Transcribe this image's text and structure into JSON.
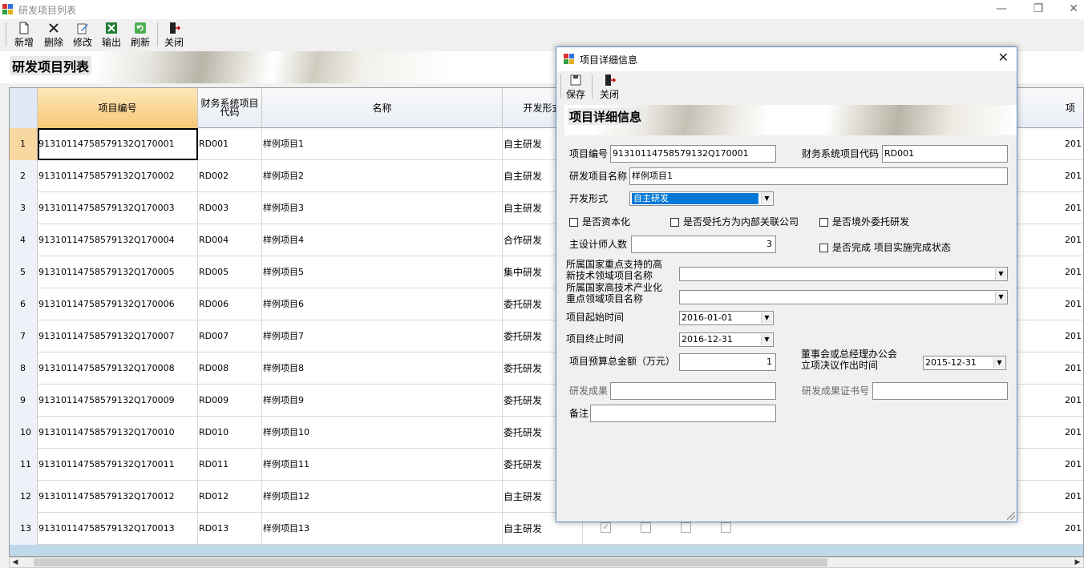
{
  "window": {
    "title": "研发项目列表"
  },
  "toolbar": {
    "new": "新增",
    "delete": "删除",
    "edit": "修改",
    "export": "输出",
    "refresh": "刷新",
    "close": "关闭"
  },
  "banner": {
    "title": "研发项目列表"
  },
  "grid": {
    "columns": [
      "项目编号",
      "财务系统项目代码",
      "名称",
      "开发形式"
    ],
    "last_col": "项",
    "rows": [
      {
        "n": "1",
        "code": "91310114758579132Q170001",
        "fin": "RD001",
        "name": "样例项目1",
        "form": "自主研发",
        "year": "201"
      },
      {
        "n": "2",
        "code": "91310114758579132Q170002",
        "fin": "RD002",
        "name": "样例项目2",
        "form": "自主研发",
        "year": "201"
      },
      {
        "n": "3",
        "code": "91310114758579132Q170003",
        "fin": "RD003",
        "name": "样例项目3",
        "form": "自主研发",
        "year": "201"
      },
      {
        "n": "4",
        "code": "91310114758579132Q170004",
        "fin": "RD004",
        "name": "样例项目4",
        "form": "合作研发",
        "year": "201"
      },
      {
        "n": "5",
        "code": "91310114758579132Q170005",
        "fin": "RD005",
        "name": "样例项目5",
        "form": "集中研发",
        "year": "201"
      },
      {
        "n": "6",
        "code": "91310114758579132Q170006",
        "fin": "RD006",
        "name": "样例项目6",
        "form": "委托研发",
        "year": "201"
      },
      {
        "n": "7",
        "code": "91310114758579132Q170007",
        "fin": "RD007",
        "name": "样例项目7",
        "form": "委托研发",
        "year": "201"
      },
      {
        "n": "8",
        "code": "91310114758579132Q170008",
        "fin": "RD008",
        "name": "样例项目8",
        "form": "委托研发",
        "year": "201"
      },
      {
        "n": "9",
        "code": "91310114758579132Q170009",
        "fin": "RD009",
        "name": "样例项目9",
        "form": "委托研发",
        "year": "201"
      },
      {
        "n": "10",
        "code": "91310114758579132Q170010",
        "fin": "RD010",
        "name": "样例项目10",
        "form": "委托研发",
        "year": "201"
      },
      {
        "n": "11",
        "code": "91310114758579132Q170011",
        "fin": "RD011",
        "name": "样例项目11",
        "form": "委托研发",
        "year": "201"
      },
      {
        "n": "12",
        "code": "91310114758579132Q170012",
        "fin": "RD012",
        "name": "样例项目12",
        "form": "自主研发",
        "year": "201"
      },
      {
        "n": "13",
        "code": "91310114758579132Q170013",
        "fin": "RD013",
        "name": "样例项目13",
        "form": "自主研发",
        "year": "201"
      }
    ]
  },
  "dialog": {
    "title": "项目详细信息",
    "save": "保存",
    "close": "关闭",
    "banner_title": "项目详细信息",
    "project_code_label": "项目编号",
    "project_code": "91310114758579132Q170001",
    "fin_code_label": "财务系统项目代码",
    "fin_code": "RD001",
    "name_label": "研发项目名称",
    "name": "样例项目1",
    "dev_form_label": "开发形式",
    "dev_form": "自主研发",
    "capitalized": "是否资本化",
    "related_party": "是否受托方为内部关联公司",
    "overseas": "是否境外委托研发",
    "designers_label": "主设计师人数",
    "designers": "3",
    "completed": "是否完成 项目实施完成状态",
    "tech_field_label_1": "所属国家重点支持的高",
    "tech_field_label_2": "新技术领域项目名称",
    "industry_label_1": "所属国家高技术产业化",
    "industry_label_2": "重点领域项目名称",
    "start_label": "项目起始时间",
    "start": "2016-01-01",
    "end_label": "项目终止时间",
    "end": "2016-12-31",
    "budget_label": "项目预算总金额（万元）",
    "budget": "1",
    "board_label_1": "董事会或总经理办公会",
    "board_label_2": "立项决议作出时间",
    "board_date": "2015-12-31",
    "result_label": "研发成果",
    "cert_label": "研发成果证书号",
    "remark_label": "备注"
  }
}
